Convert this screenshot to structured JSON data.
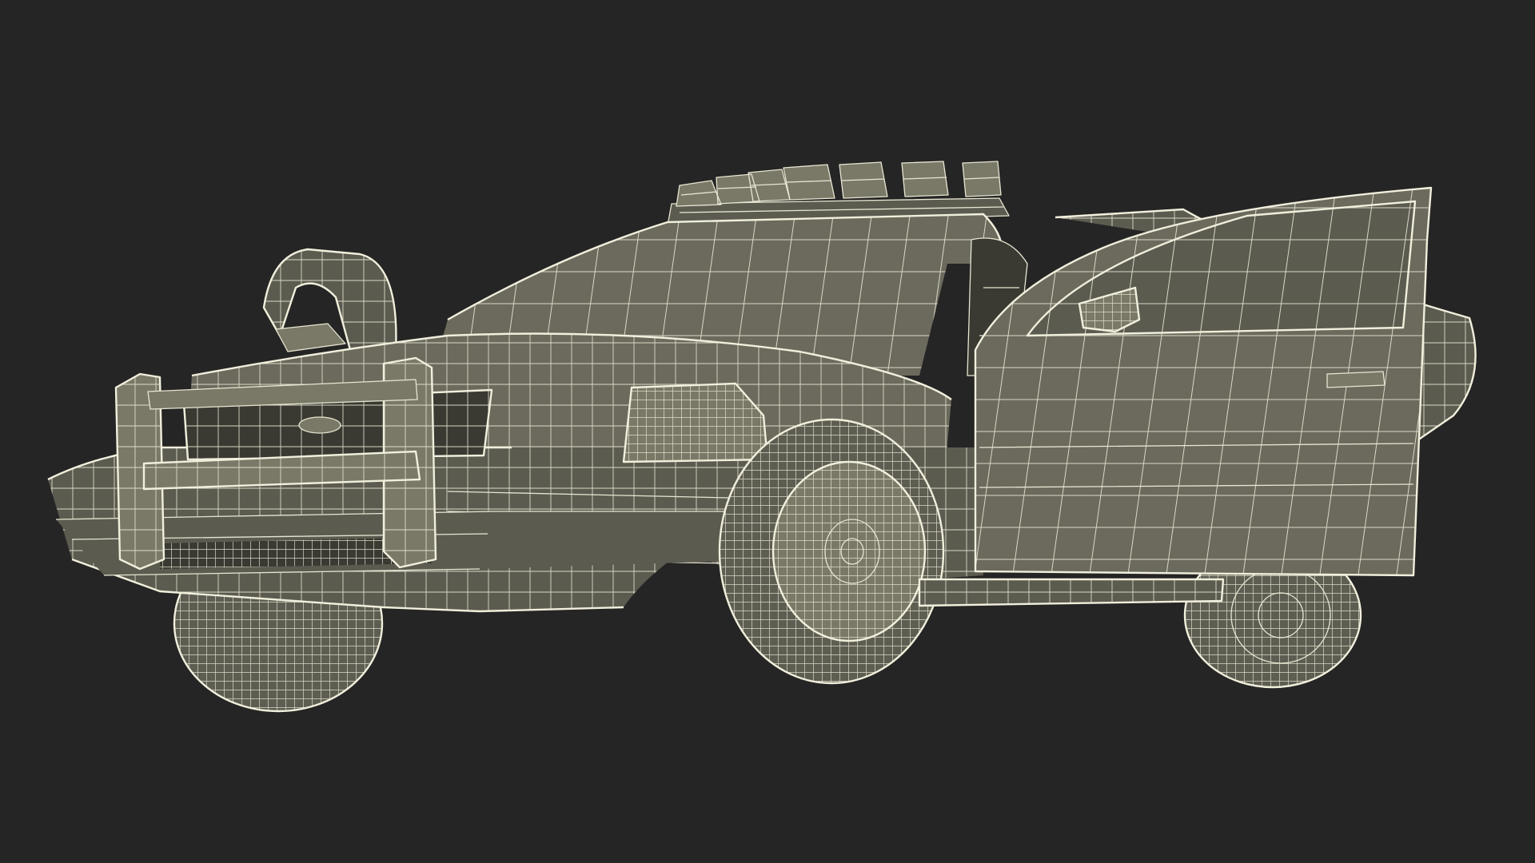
{
  "scene": {
    "background_color": "#262525",
    "model_fill_color": "#6b6a5d",
    "wireframe_color": "#e8e6d2"
  }
}
